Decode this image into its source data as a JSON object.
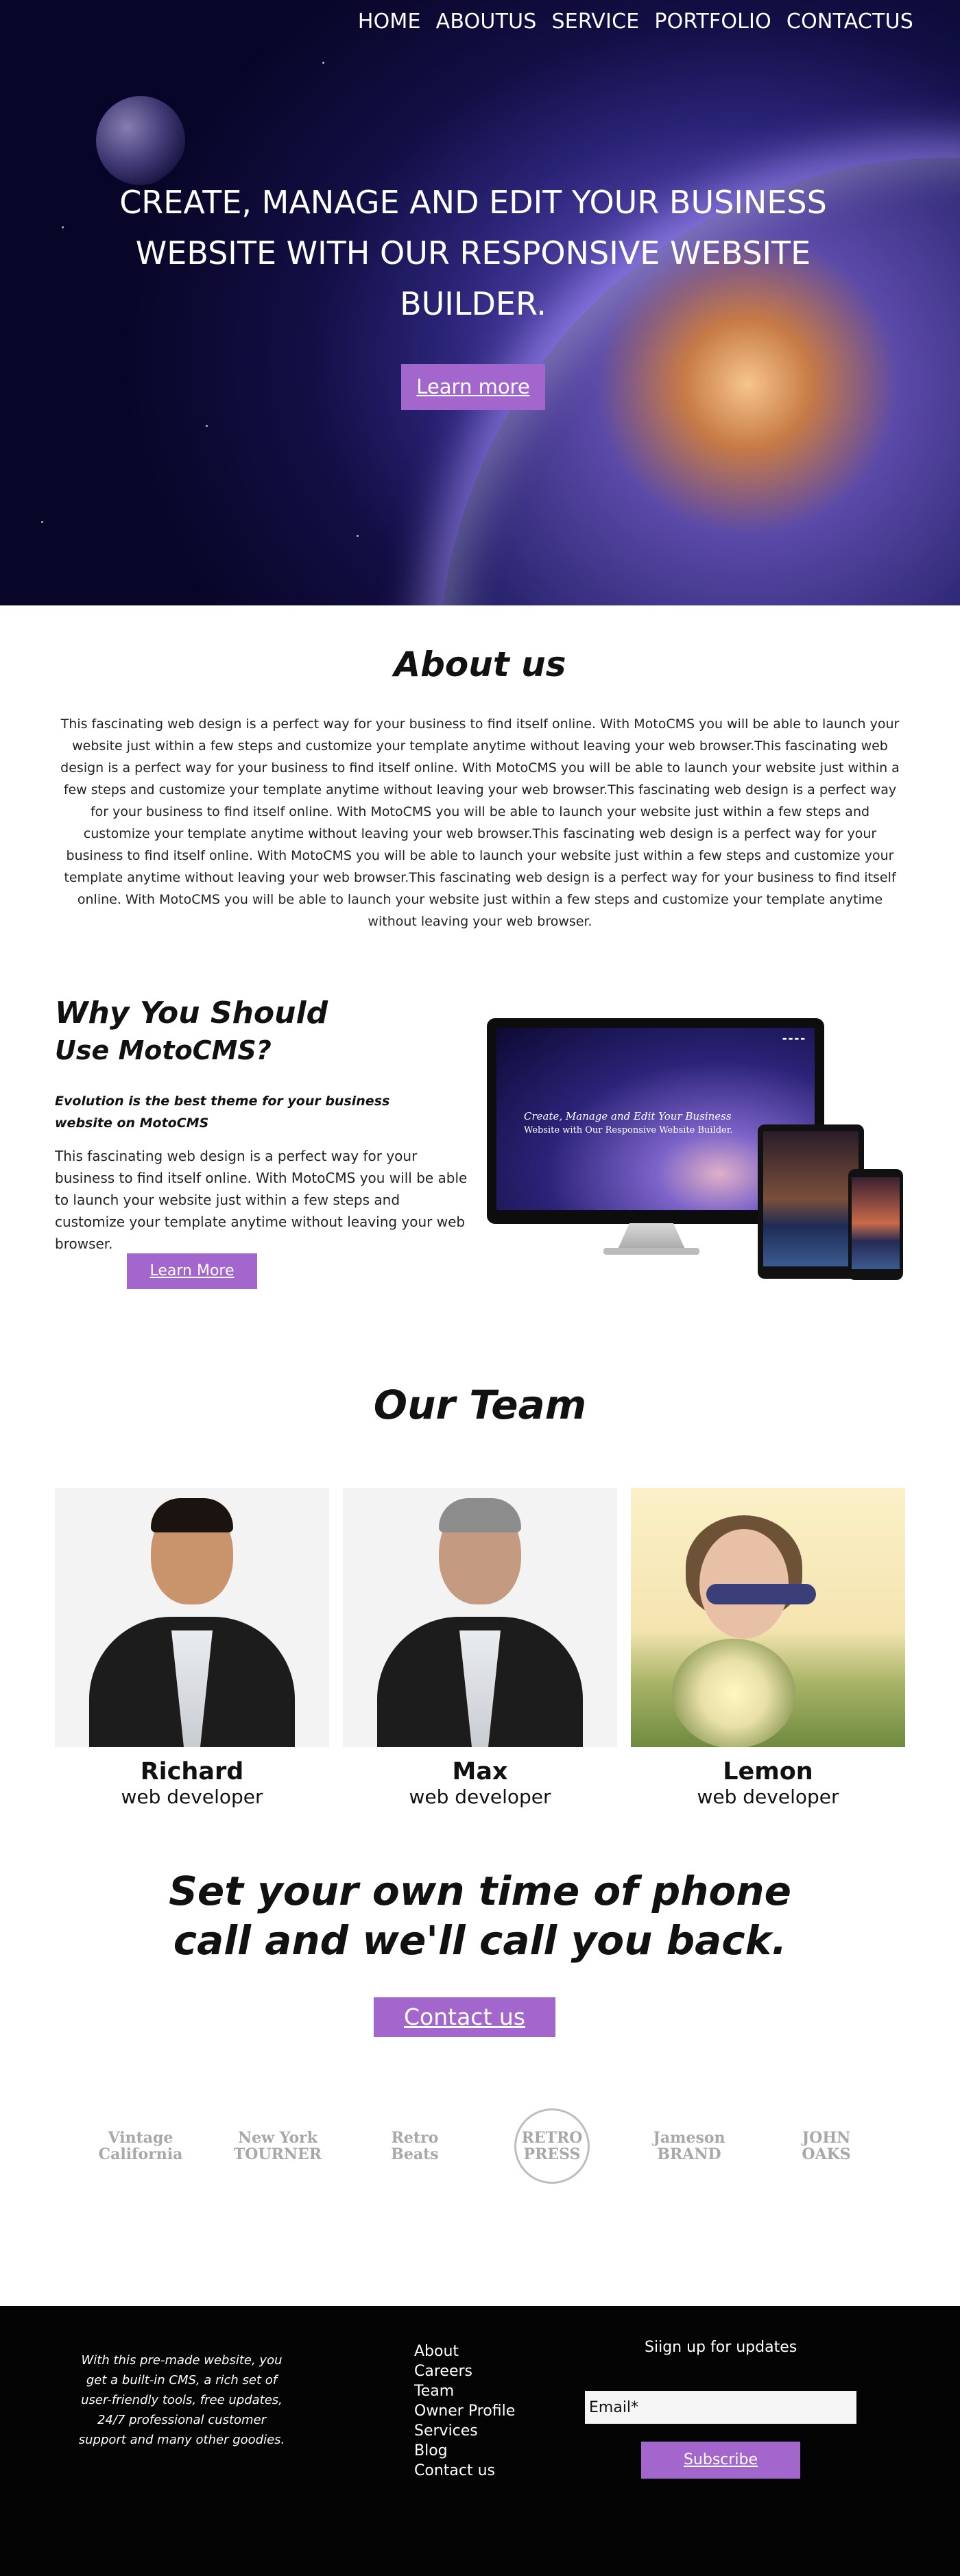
{
  "nav": {
    "items": [
      "HOME",
      "ABOUTUS",
      "SERVICE",
      "PORTFOLIO",
      "CONTACTUS"
    ]
  },
  "hero": {
    "title": "CREATE, MANAGE AND EDIT YOUR BUSINESS WEBSITE WITH OUR RESPONSIVE WEBSITE BUILDER.",
    "button": "Learn more"
  },
  "about": {
    "title": "About us",
    "text": "This fascinating web design is a perfect way for your business to find itself online. With MotoCMS you will be able to launch your website just within a few steps and customize your template anytime without leaving your web browser.This fascinating web design is a perfect way for your business to find itself online. With MotoCMS you will be able to launch your website just within a few steps and customize your template anytime without leaving your web browser.This fascinating web design is a perfect way for your business to find itself online. With MotoCMS you will be able to launch your website just within a few steps and customize your template anytime without leaving your web browser.This fascinating web design is a perfect way for your business to find itself online. With MotoCMS you will be able to launch your website just within a few steps and customize your template anytime without leaving your web browser.This fascinating web design is a perfect way for your business to find itself online. With MotoCMS you will be able to launch your website just within a few steps and customize your template anytime without leaving your web browser."
  },
  "why": {
    "title_line1": "Why You Should",
    "title_line2": "Use MotoCMS?",
    "subtitle": "Evolution is the best theme for your business website on MotoCMS",
    "text": "This fascinating web design is a perfect way for your business to find itself online. With MotoCMS you will be able to launch your website just within a few steps and customize your template anytime without leaving your web browser.",
    "button": "Learn More",
    "monitor_title": "Create, Manage and Edit Your Business",
    "monitor_subtitle": "Website with Our Responsive Website Builder."
  },
  "team": {
    "title": "Our Team",
    "members": [
      {
        "name": "Richard",
        "role": "web developer"
      },
      {
        "name": "Max",
        "role": "web developer"
      },
      {
        "name": "Lemon",
        "role": "web developer"
      }
    ]
  },
  "callback": {
    "line1": "Set your own time of phone",
    "line2": "call and we'll call you back.",
    "button": "Contact us"
  },
  "logos": [
    {
      "line1": "Vintage",
      "line2": "California"
    },
    {
      "line1": "New York",
      "line2": "TOURNER"
    },
    {
      "line1": "Retro",
      "line2": "Beats"
    },
    {
      "line1": "RETRO",
      "line2": "PRESS"
    },
    {
      "line1": "Jameson",
      "line2": "BRAND"
    },
    {
      "line1": "JOHN",
      "line2": "OAKS"
    }
  ],
  "footer": {
    "text": "With this pre-made website, you get a built-in CMS, a rich set of user-friendly tools, free updates, 24/7 professional customer support and many other goodies.",
    "links": [
      "About",
      "Careers",
      "Team",
      "Owner Profile",
      "Services",
      "Blog",
      "Contact us"
    ],
    "signup_title": "Siign up for updates",
    "email_placeholder": "Email*",
    "subscribe_button": "Subscribe"
  },
  "colors": {
    "accent": "#a366cc",
    "footer_bg": "#040404"
  }
}
